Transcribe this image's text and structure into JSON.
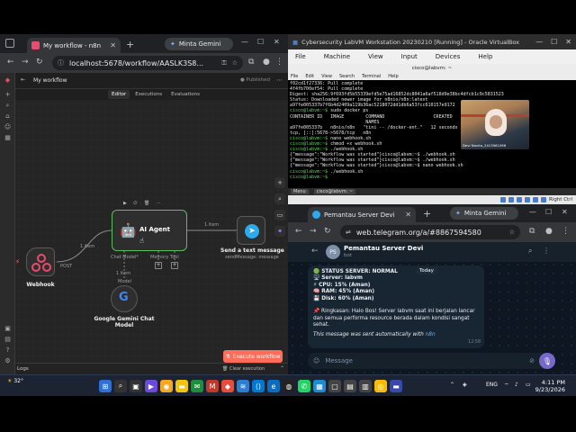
{
  "browser_left": {
    "tab_title": "My workflow - n8n",
    "gemini_label": "Minta Gemini",
    "url": "localhost:5678/workflow/AASLK3S8..."
  },
  "n8n": {
    "workflow_name": "My workflow",
    "published_label": "Published",
    "tabs": [
      "Editor",
      "Executions",
      "Evaluations"
    ],
    "nodes": {
      "webhook": {
        "label": "Webhook"
      },
      "agent": {
        "label": "AI Agent",
        "inputs": [
          "Chat Model*",
          "Memory",
          "Tool"
        ]
      },
      "telegram": {
        "label": "Send a text message",
        "sub": "sendMessage: message"
      },
      "gemini": {
        "label": "Google Gemini Chat Model",
        "port": "Model"
      }
    },
    "edges": {
      "webhook_agent": "1 item",
      "agent_telegram": "1 item",
      "agent_model": "1 item",
      "post_label": "POST"
    },
    "execute_label": "Execute workflow",
    "logs_label": "Logs",
    "clear_label": "Clear execution"
  },
  "vbox": {
    "title": "Cybersecurity LabVM Workstation 20230210 [Running] - Oracle VirtualBox",
    "menu": [
      "File",
      "Machine",
      "View",
      "Input",
      "Devices",
      "Help"
    ],
    "terminal_title": "cisco@labvm: ~",
    "terminal_menu": [
      "File",
      "Edit",
      "View",
      "Search",
      "Terminal",
      "Help"
    ],
    "terminal_lines": [
      "f02cd1f27336: Pull complete",
      "4f4fb700ef54: Pull complete",
      "Digest: sha256:9f693fd5b55339efd5e75ad16852dc8041a6af518d9e38bc4dfcb1c9c5831523",
      "Status: Downloaded newer image for n8nio/n8n:latest",
      "a97fe005337b7f6b4d2409a119b36ac5218072dd1db6a53fcc610157e9172",
      "cisco@labvm:~$ sudo docker ps",
      "CONTAINER ID   IMAGE        COMMAND                  CREATED",
      "                            NAMES",
      "a97fe005337b   n8nio/n8n   \"tini -- /docker-ent.\"   12 seconds ago   Up 1",
      "tcp, [::]:5678->5678/tcp   n8n",
      "cisco@labvm:~$ nano webhook.sh",
      "cisco@labvm:~$ chmod +x webhook.sh",
      "cisco@labvm:~$ ./webhook.sh",
      "{\"message\":\"Workflow was started\"}cisco@labvm:~$ ./webhook.sh",
      "{\"message\":\"Workflow was started\"}cisco@labvm:~$ ./webhook.sh",
      "{\"message\":\"Workflow was started\"}cisco@labvm:~$ nano webhook.sh",
      "cisco@labvm:~$ ./webhook.sh",
      "cisco@labvm:~$ "
    ],
    "webcam_name": "Devi Novita_2413061066",
    "panel_items": [
      "Menu",
      "cisco@labvm: ~"
    ],
    "status_right": "Right Ctrl"
  },
  "browser_tg": {
    "tab_title": "Pemantau Server Devi",
    "gemini_label": "Minta Gemini",
    "url": "web.telegram.org/a/#8867594580"
  },
  "telegram": {
    "chat_name": "Pemantau Server Devi",
    "chat_sub": "bot",
    "avatar": "PS",
    "date_badge": "Today",
    "message_lines": [
      "🟢 STATUS SERVER: NORMAL",
      "🖥️ Server: labvm",
      "⚡ CPU: 15% (Aman)",
      "🧠 RAM: 45% (Aman)",
      "💾 Disk: 60% (Aman)",
      "",
      "📌 Ringkasan: Halo Bos! Server labvm saat ini berjalan lancar",
      "dan semua performa resource berada dalam kondisi sangat",
      "sehat."
    ],
    "footer_text": "This message was sent automatically with",
    "footer_link": "n8n",
    "time": "12:58",
    "input_placeholder": "Message"
  },
  "taskbar": {
    "weather": "32°",
    "lang": "ENG",
    "time": "4:11 PM",
    "date": "9/23/2026"
  }
}
